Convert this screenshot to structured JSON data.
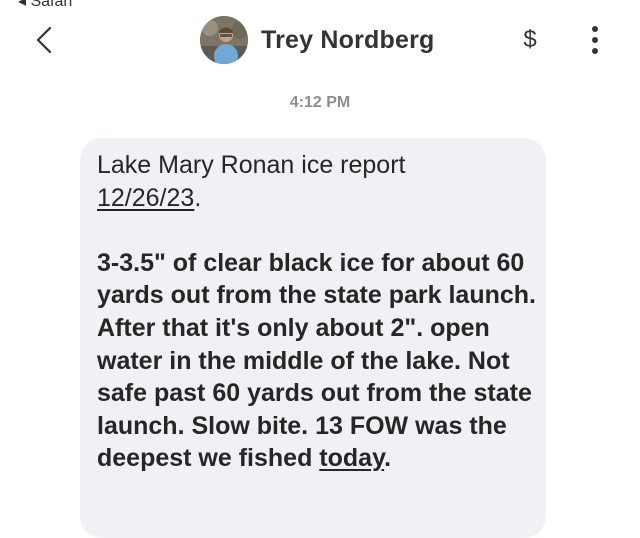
{
  "status_bar": {
    "back_app": "◂ Safari"
  },
  "header": {
    "contact_name": "Trey Nordberg",
    "back_icon": "chevron-left-icon",
    "pay_icon": "dollar-icon",
    "pay_label": "$",
    "more_icon": "vertical-dots-icon"
  },
  "conversation": {
    "timestamp": "4:12 PM",
    "message": {
      "line1": "Lake Mary Ronan ice report",
      "date": "12/26/23",
      "date_suffix": ".",
      "body_main": "3-3.5\" of clear black ice for about 60 yards out from the state park launch. After that it's only about 2\". open water in the middle of the lake. Not safe past 60 yards out from the state launch. Slow bite. 13 FOW was the deepest we fished ",
      "body_link": "today",
      "body_end": "."
    }
  }
}
